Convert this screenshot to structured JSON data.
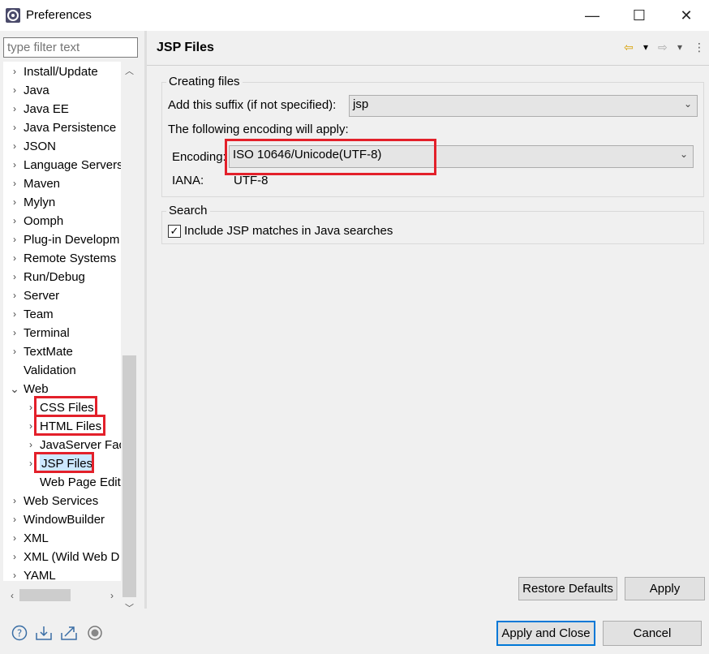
{
  "window": {
    "title": "Preferences",
    "minimize_glyph": "—",
    "maximize_glyph": "☐",
    "close_glyph": "✕"
  },
  "filter": {
    "placeholder": "type filter text"
  },
  "tree": {
    "items": [
      {
        "label": "Install/Update",
        "chevron": "›"
      },
      {
        "label": "Java",
        "chevron": "›"
      },
      {
        "label": "Java EE",
        "chevron": "›"
      },
      {
        "label": "Java Persistence",
        "chevron": "›"
      },
      {
        "label": "JSON",
        "chevron": "›"
      },
      {
        "label": "Language Servers",
        "chevron": "›"
      },
      {
        "label": "Maven",
        "chevron": "›"
      },
      {
        "label": "Mylyn",
        "chevron": "›"
      },
      {
        "label": "Oomph",
        "chevron": "›"
      },
      {
        "label": "Plug-in Developm",
        "chevron": "›"
      },
      {
        "label": "Remote Systems",
        "chevron": "›"
      },
      {
        "label": "Run/Debug",
        "chevron": "›"
      },
      {
        "label": "Server",
        "chevron": "›"
      },
      {
        "label": "Team",
        "chevron": "›"
      },
      {
        "label": "Terminal",
        "chevron": "›"
      },
      {
        "label": "TextMate",
        "chevron": "›"
      },
      {
        "label": "Validation",
        "chevron": ""
      },
      {
        "label": "Web",
        "chevron": "⌄"
      },
      {
        "label": "CSS Files",
        "chevron": "›"
      },
      {
        "label": "HTML Files",
        "chevron": "›"
      },
      {
        "label": "JavaServer Face",
        "chevron": "›"
      },
      {
        "label": "JSP Files",
        "chevron": "›"
      },
      {
        "label": "Web Page Edit",
        "chevron": ""
      },
      {
        "label": "Web Services",
        "chevron": "›"
      },
      {
        "label": "WindowBuilder",
        "chevron": "›"
      },
      {
        "label": "XML",
        "chevron": "›"
      },
      {
        "label": "XML (Wild Web D",
        "chevron": "›"
      },
      {
        "label": "YAML",
        "chevron": "›"
      }
    ],
    "selected": "JSP Files"
  },
  "page": {
    "title": "JSP Files",
    "nav_back": "⇦",
    "nav_forward": "⇨",
    "nav_dropdown": "▾",
    "nav_menu": "⋮"
  },
  "creating_files": {
    "group_title": "Creating files",
    "suffix_label": "Add this suffix (if not specified):",
    "suffix_value": "jsp",
    "encoding_note": "The following encoding will apply:",
    "encoding_label": "Encoding:",
    "encoding_value": "ISO 10646/Unicode(UTF-8)",
    "iana_label": "IANA:",
    "iana_value": "UTF-8"
  },
  "search": {
    "group_title": "Search",
    "checkbox_label": "Include JSP matches in Java searches",
    "checkbox_checked": true
  },
  "buttons": {
    "restore_defaults": "Restore Defaults",
    "apply": "Apply",
    "apply_and_close": "Apply and Close",
    "cancel": "Cancel"
  },
  "bottom_icons": [
    "help-icon",
    "import-icon",
    "export-icon",
    "record-icon"
  ],
  "colors": {
    "highlight_red": "#e3202a",
    "primary_border": "#0078d7"
  }
}
